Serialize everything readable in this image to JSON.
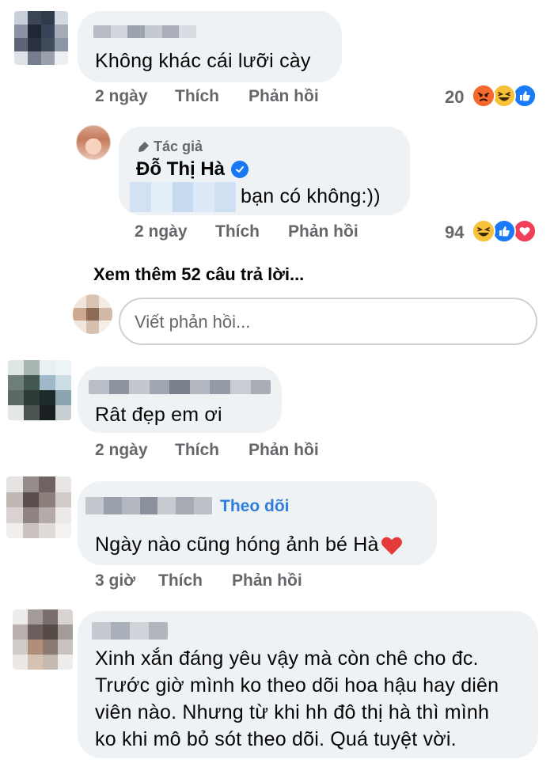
{
  "comments": [
    {
      "text": "Không khác cái lưỡi cày",
      "time": "2 ngày",
      "like": "Thích",
      "reply": "Phản hồi",
      "reaction_count": "20",
      "reactions": [
        "angry-icon",
        "haha-icon",
        "like-icon"
      ]
    },
    {
      "text": "Rât đẹp em ơi",
      "time": "2 ngày",
      "like": "Thích",
      "reply": "Phản hồi"
    },
    {
      "follow": "Theo dõi",
      "text": "Ngày nào cũng hóng ảnh bé Hà",
      "time": "3 giờ",
      "like": "Thích",
      "reply": "Phản hồi"
    },
    {
      "lines": [
        "Xinh xắn đáng yêu vậy mà còn chê cho đc.",
        "Trước giờ mình ko theo dõi hoa hậu hay diên",
        "viên nào. Nhưng từ khi hh đô thị hà thì mình",
        "ko khi mô bỏ sót theo dõi. Quá tuyệt vời."
      ]
    }
  ],
  "author_reply": {
    "badge": "Tác giả",
    "name": "Đỗ Thị Hà",
    "text": "bạn có không:))",
    "time": "2 ngày",
    "like": "Thích",
    "reply": "Phản hồi",
    "reaction_count": "94",
    "reactions": [
      "haha-icon",
      "like-icon",
      "love-icon"
    ]
  },
  "see_more": "Xem thêm 52 câu trả lời...",
  "reply_input": {
    "placeholder": "Viết phản hồi..."
  },
  "colors": {
    "bubble": "#eff2f5",
    "meta": "#65676b",
    "follow": "#2f7ddd",
    "verified": "#1877f2"
  }
}
